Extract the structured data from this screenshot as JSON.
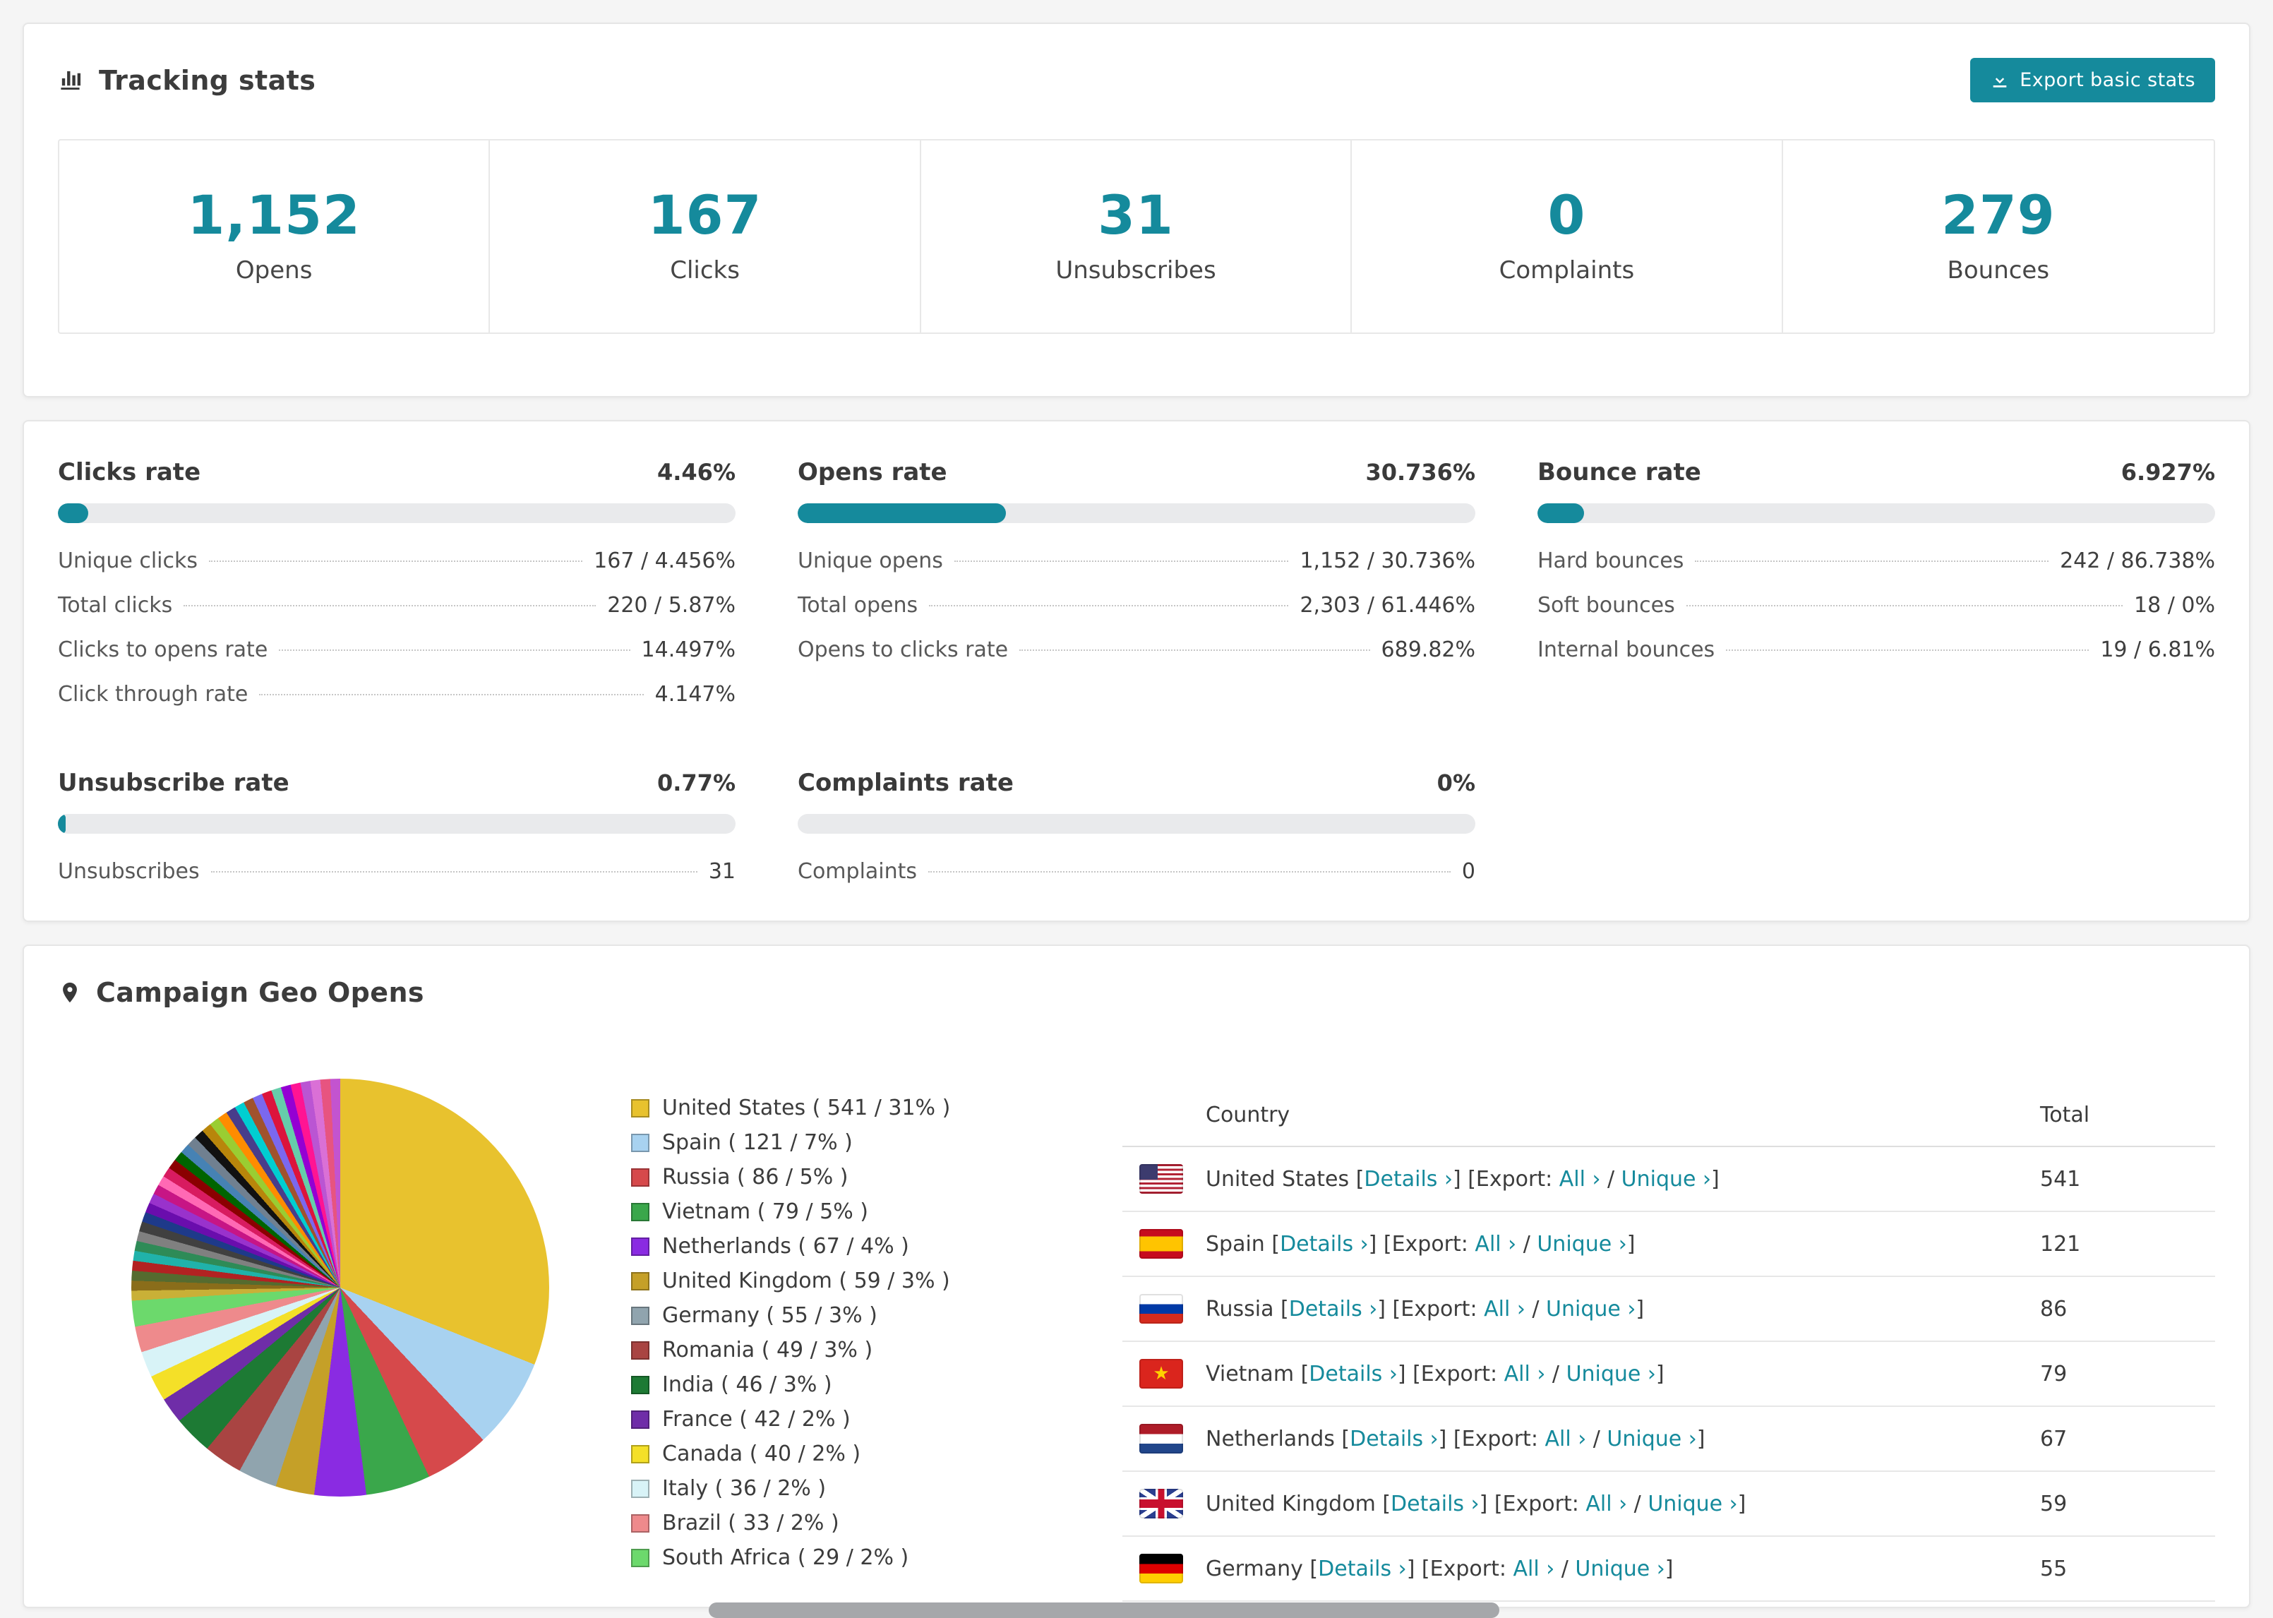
{
  "colors": {
    "accent": "#158a9c"
  },
  "tracking": {
    "title": "Tracking stats",
    "export_label": "Export basic stats",
    "stats": [
      {
        "value": "1,152",
        "label": "Opens"
      },
      {
        "value": "167",
        "label": "Clicks"
      },
      {
        "value": "31",
        "label": "Unsubscribes"
      },
      {
        "value": "0",
        "label": "Complaints"
      },
      {
        "value": "279",
        "label": "Bounces"
      }
    ]
  },
  "rates": [
    {
      "title": "Clicks rate",
      "pct_label": "4.46%",
      "pct": 4.46,
      "rows": [
        {
          "label": "Unique clicks",
          "value": "167 / 4.456%"
        },
        {
          "label": "Total clicks",
          "value": "220 / 5.87%"
        },
        {
          "label": "Clicks to opens rate",
          "value": "14.497%"
        },
        {
          "label": "Click through rate",
          "value": "4.147%"
        }
      ]
    },
    {
      "title": "Opens rate",
      "pct_label": "30.736%",
      "pct": 30.736,
      "rows": [
        {
          "label": "Unique opens",
          "value": "1,152 / 30.736%"
        },
        {
          "label": "Total opens",
          "value": "2,303 / 61.446%"
        },
        {
          "label": "Opens to clicks rate",
          "value": "689.82%"
        }
      ]
    },
    {
      "title": "Bounce rate",
      "pct_label": "6.927%",
      "pct": 6.927,
      "rows": [
        {
          "label": "Hard bounces",
          "value": "242 / 86.738%"
        },
        {
          "label": "Soft bounces",
          "value": "18 / 0%"
        },
        {
          "label": "Internal bounces",
          "value": "19 / 6.81%"
        }
      ]
    },
    {
      "title": "Unsubscribe rate",
      "pct_label": "0.77%",
      "pct": 0.77,
      "rows": [
        {
          "label": "Unsubscribes",
          "value": "31"
        }
      ]
    },
    {
      "title": "Complaints rate",
      "pct_label": "0%",
      "pct": 0,
      "rows": [
        {
          "label": "Complaints",
          "value": "0"
        }
      ]
    }
  ],
  "chart_data": {
    "type": "pie",
    "title": "Campaign Geo Opens",
    "legend_position": "right",
    "slices": [
      {
        "label": "United States",
        "value": 541,
        "pct": 31,
        "color": "#e8c22e"
      },
      {
        "label": "Spain",
        "value": 121,
        "pct": 7,
        "color": "#a8d2f0"
      },
      {
        "label": "Russia",
        "value": 86,
        "pct": 5,
        "color": "#d6494b"
      },
      {
        "label": "Vietnam",
        "value": 79,
        "pct": 5,
        "color": "#3aa74b"
      },
      {
        "label": "Netherlands",
        "value": 67,
        "pct": 4,
        "color": "#8a2be2"
      },
      {
        "label": "United Kingdom",
        "value": 59,
        "pct": 3,
        "color": "#c5a028"
      },
      {
        "label": "Germany",
        "value": 55,
        "pct": 3,
        "color": "#90a4ae"
      },
      {
        "label": "Romania",
        "value": 49,
        "pct": 3,
        "color": "#a94442"
      },
      {
        "label": "India",
        "value": 46,
        "pct": 3,
        "color": "#1d7a34"
      },
      {
        "label": "France",
        "value": 42,
        "pct": 2,
        "color": "#6f2da8"
      },
      {
        "label": "Canada",
        "value": 40,
        "pct": 2,
        "color": "#f4e028"
      },
      {
        "label": "Italy",
        "value": 36,
        "pct": 2,
        "color": "#d8f3f7"
      },
      {
        "label": "Brazil",
        "value": 33,
        "pct": 2,
        "color": "#ee8a8c"
      },
      {
        "label": "South Africa",
        "value": 29,
        "pct": 2,
        "color": "#6cd96c"
      }
    ],
    "others": {
      "total_pct": 26,
      "colors": [
        "#c9b037",
        "#8a6d1a",
        "#556b2f",
        "#b22222",
        "#20b2aa",
        "#2e8b57",
        "#808080",
        "#404040",
        "#1e3a8a",
        "#6a0dad",
        "#9932cc",
        "#c71585",
        "#ff69b4",
        "#d81b60",
        "#8b0000",
        "#006400",
        "#4682b4",
        "#708090",
        "#111111",
        "#b8860b",
        "#9acd32",
        "#ff8c00",
        "#483d8b",
        "#00ced1",
        "#a0522d",
        "#7b68ee",
        "#dc143c",
        "#66cdaa",
        "#9400d3",
        "#ff1493",
        "#ba55d3",
        "#da70d6",
        "#e75480",
        "#c354cf"
      ]
    }
  },
  "geo": {
    "title": "Campaign Geo Opens",
    "table": {
      "headers": [
        "Country",
        "Total"
      ],
      "details": "Details ›",
      "export": "Export:",
      "all": "All ›",
      "unique": "Unique ›",
      "punct": {
        "lb": "[",
        "rb": "]",
        "sep": "/"
      },
      "rows": [
        {
          "country": "United States",
          "total": "541",
          "flag": "us"
        },
        {
          "country": "Spain",
          "total": "121",
          "flag": "es"
        },
        {
          "country": "Russia",
          "total": "86",
          "flag": "ru"
        },
        {
          "country": "Vietnam",
          "total": "79",
          "flag": "vn"
        },
        {
          "country": "Netherlands",
          "total": "67",
          "flag": "nl"
        },
        {
          "country": "United Kingdom",
          "total": "59",
          "flag": "gb"
        },
        {
          "country": "Germany",
          "total": "55",
          "flag": "de"
        }
      ]
    }
  }
}
